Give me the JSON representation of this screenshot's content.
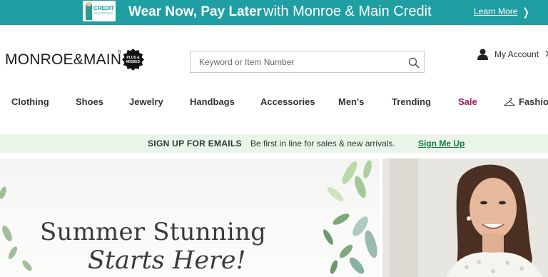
{
  "promo": {
    "card_text": "CREDIT",
    "headline": "Wear Now, Pay Later",
    "subline": "with Monroe & Main Credit",
    "link": "Learn More",
    "bg_color": "#1f9ea4"
  },
  "header": {
    "logo_text": "MONROE&MAIN",
    "logo_mark": "®",
    "badge_text": "PLUS & MISSES",
    "search_placeholder": "Keyword or Item Number",
    "account_label": "My Account"
  },
  "nav": {
    "items": [
      "Clothing",
      "Shoes",
      "Jewelry",
      "Handbags",
      "Accessories",
      "Men's",
      "Trending",
      "Sale",
      "Fashion"
    ],
    "sale_color": "#a4155e"
  },
  "email_bar": {
    "title": "SIGN UP FOR EMAILS",
    "text": "Be first in line for sales & new arrivals.",
    "link": "Sign Me Up",
    "bg_color": "#eaf5e9",
    "link_color": "#137a43"
  },
  "hero": {
    "line1": "Summer Stunning",
    "line2": "Starts Here!"
  }
}
